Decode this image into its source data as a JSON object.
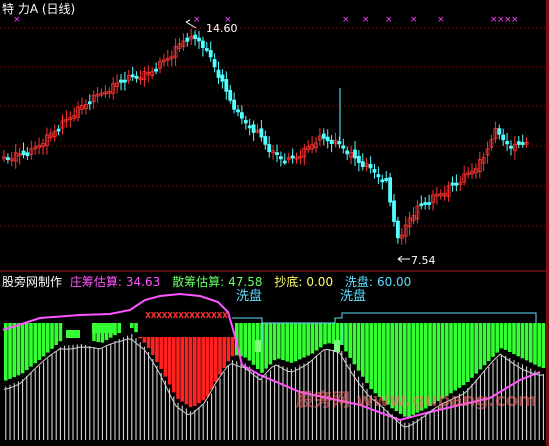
{
  "header": {
    "title": "特  力A (日线)"
  },
  "price_chart": {
    "high_label": "14.60",
    "low_label": "7.54",
    "up_color": "#ff3333",
    "down_color": "#54ffff",
    "marker_glyph": "×",
    "marker_color": "#ff44ff"
  },
  "indicator": {
    "name": "股旁网制作",
    "zc": {
      "label": "庄筹估算:",
      "value": "34.63",
      "color": "#ff55ff"
    },
    "sc": {
      "label": "散筹估算:",
      "value": "47.58",
      "color": "#66ff66"
    },
    "cd": {
      "label": "抄底:",
      "value": "0.00",
      "color": "#ffff66"
    },
    "xp": {
      "label": "洗盘:",
      "value": "60.00",
      "color": "#5fe0ff"
    },
    "wash_tag_1": "洗盘",
    "wash_tag_2": "洗盘",
    "green_color": "#33ff33",
    "red_color": "#ff2222",
    "white_bar_color": "#e8e8e8"
  },
  "watermark": "股旁网 www.gupang.com",
  "icons": [
    "arrow-icon",
    "x-marker-icon"
  ]
}
